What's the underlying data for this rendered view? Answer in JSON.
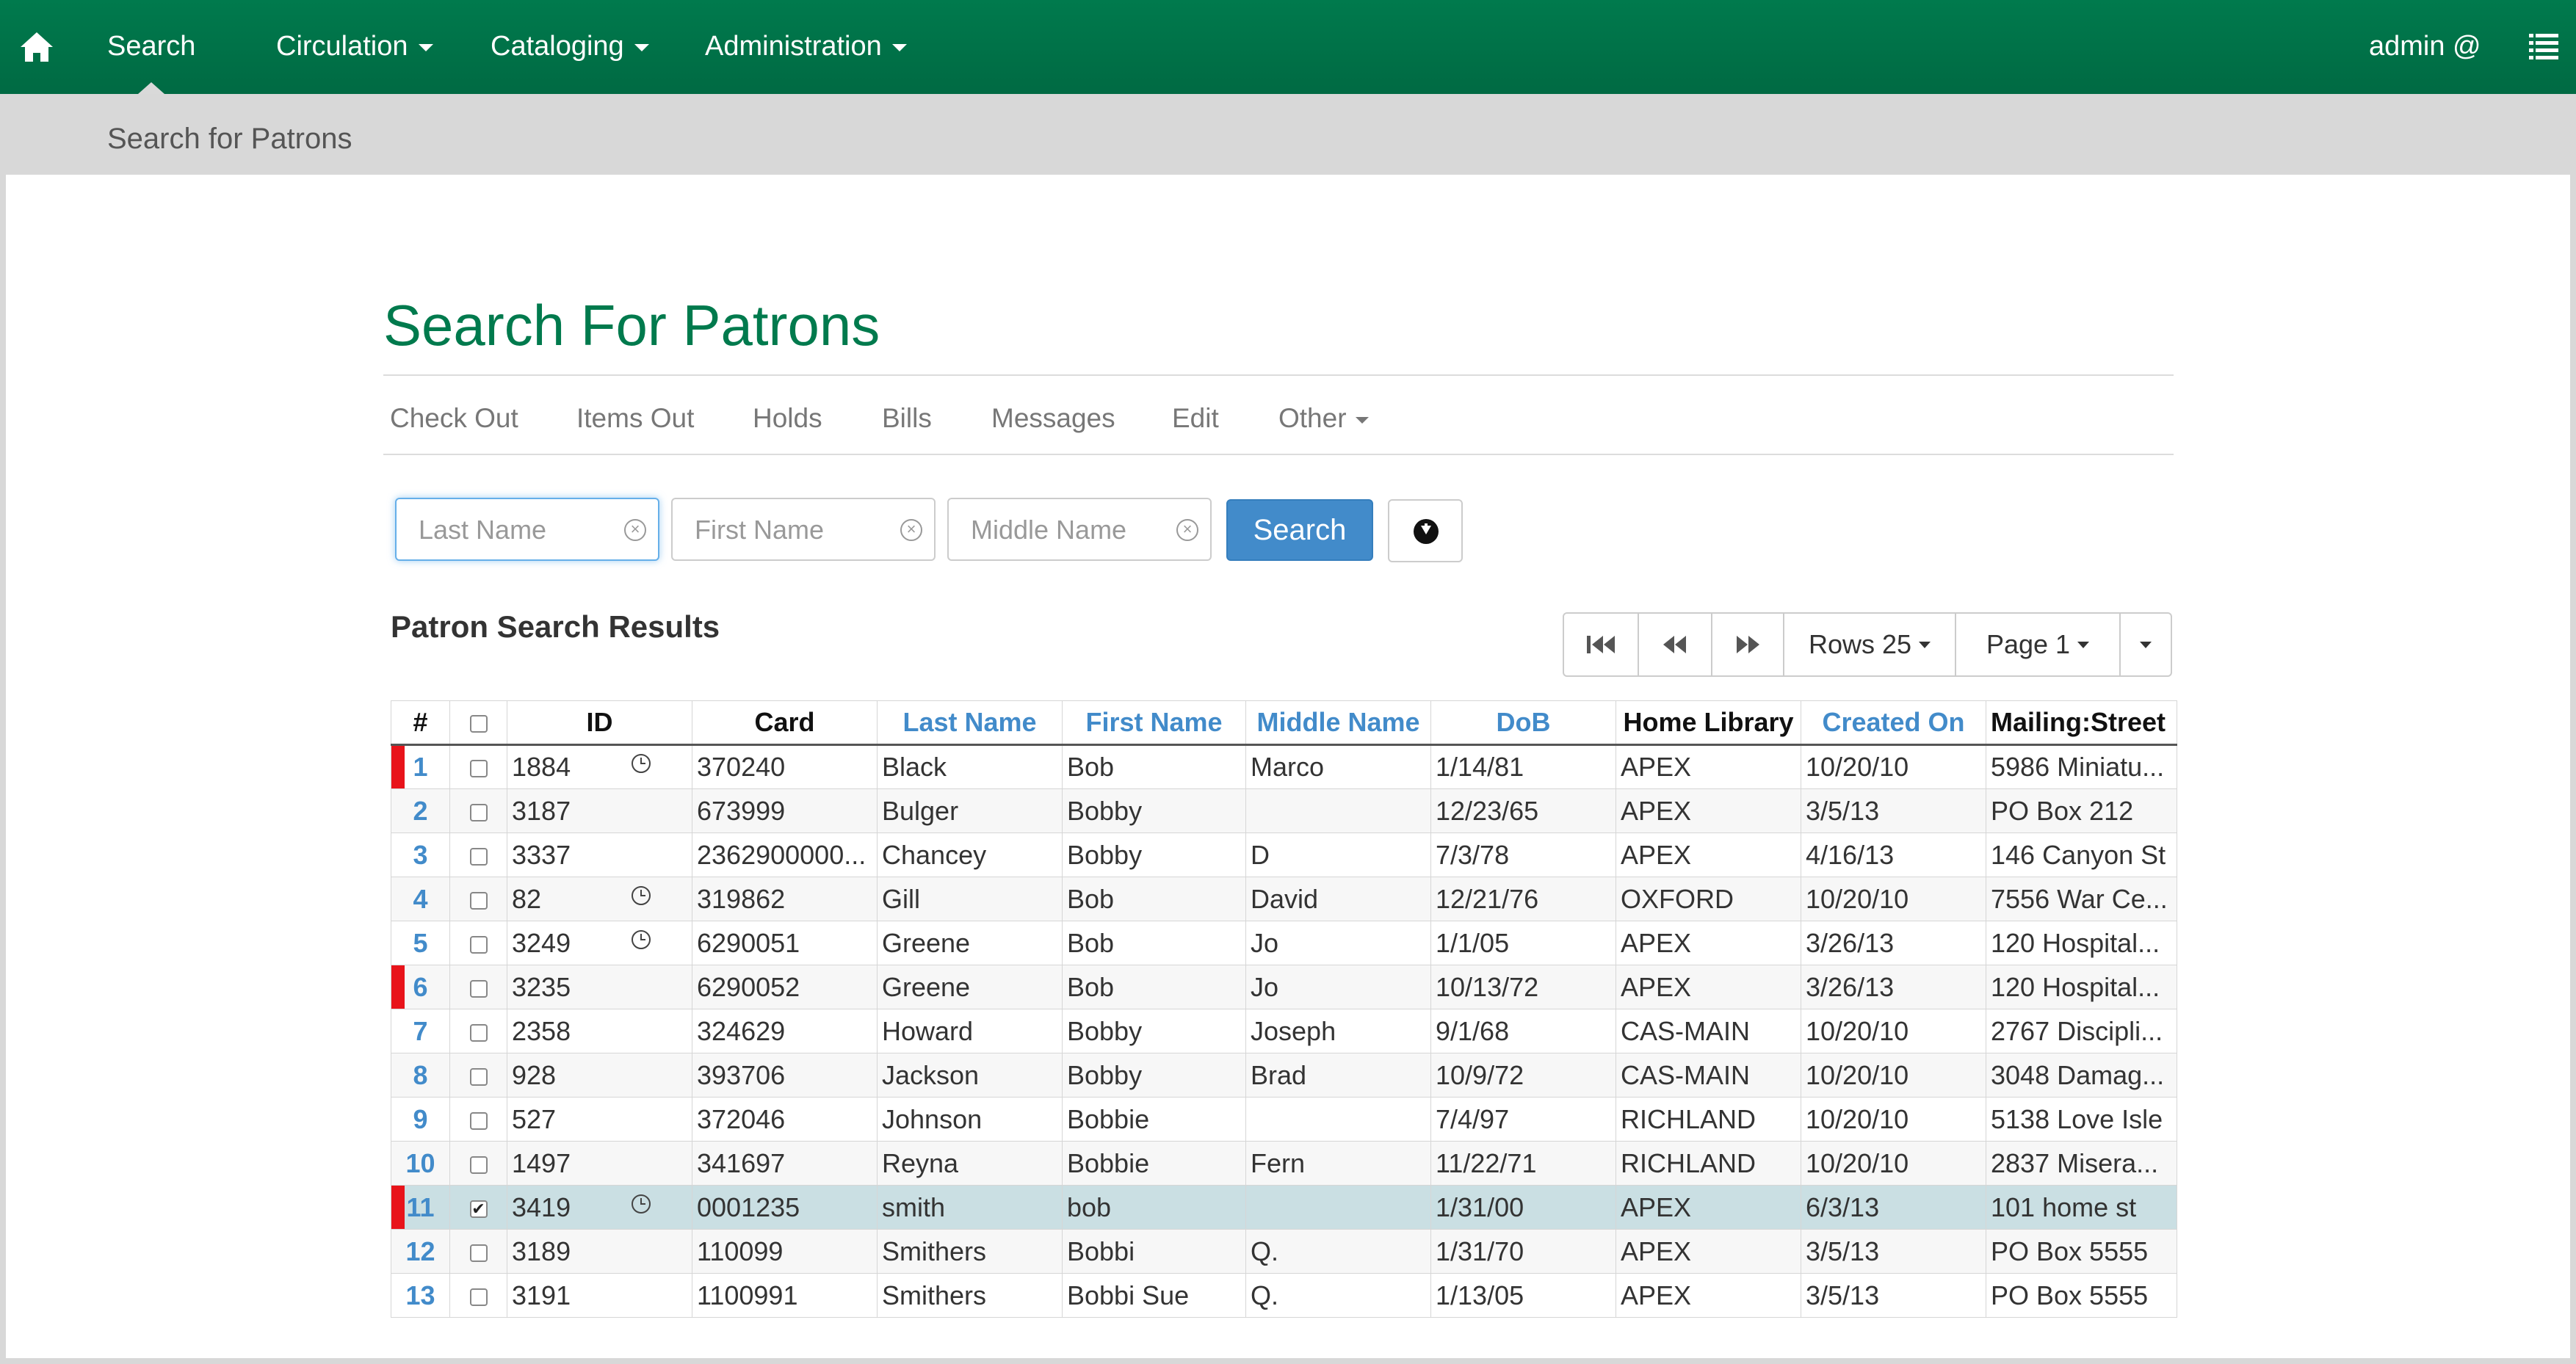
{
  "navbar": {
    "home_icon": "home-icon",
    "items": [
      {
        "label": "Search",
        "active": true
      },
      {
        "label": "Circulation",
        "dropdown": true
      },
      {
        "label": "Cataloging",
        "dropdown": true
      },
      {
        "label": "Administration",
        "dropdown": true
      }
    ],
    "user": "admin @",
    "menu_icon": "hamburger-menu-icon",
    "color": "#007a4d"
  },
  "subheader": {
    "title": "Search for Patrons"
  },
  "page": {
    "title": "Search For Patrons"
  },
  "actions": [
    "Check Out",
    "Items Out",
    "Holds",
    "Bills",
    "Messages",
    "Edit",
    "Other"
  ],
  "search": {
    "last_name_placeholder": "Last Name",
    "first_name_placeholder": "First Name",
    "middle_name_placeholder": "Middle Name",
    "search_label": "Search",
    "download_icon": "download-circle-icon"
  },
  "results": {
    "title": "Patron Search Results",
    "pager": {
      "rows_label": "Rows 25",
      "page_label": "Page 1"
    }
  },
  "table": {
    "columns": [
      "#",
      "",
      "ID",
      "Card",
      "Last Name",
      "First Name",
      "Middle Name",
      "DoB",
      "Home Library",
      "Created On",
      "Mailing:Street"
    ],
    "rows": [
      {
        "num": "1",
        "flag": true,
        "checked": false,
        "id": "1884",
        "clock": true,
        "card": "370240",
        "last": "Black",
        "first": "Bob",
        "middle": "Marco",
        "dob": "1/14/81",
        "lib": "APEX",
        "created": "10/20/10",
        "street": "5986 Miniatu..."
      },
      {
        "num": "2",
        "flag": false,
        "checked": false,
        "id": "3187",
        "clock": false,
        "card": "673999",
        "last": "Bulger",
        "first": "Bobby",
        "middle": "",
        "dob": "12/23/65",
        "lib": "APEX",
        "created": "3/5/13",
        "street": "PO Box 212"
      },
      {
        "num": "3",
        "flag": false,
        "checked": false,
        "id": "3337",
        "clock": false,
        "card": "2362900000...",
        "last": "Chancey",
        "first": "Bobby",
        "middle": "D",
        "dob": "7/3/78",
        "lib": "APEX",
        "created": "4/16/13",
        "street": "146 Canyon St"
      },
      {
        "num": "4",
        "flag": false,
        "checked": false,
        "id": "82",
        "clock": true,
        "card": "319862",
        "last": "Gill",
        "first": "Bob",
        "middle": "David",
        "dob": "12/21/76",
        "lib": "OXFORD",
        "created": "10/20/10",
        "street": "7556 War Ce..."
      },
      {
        "num": "5",
        "flag": false,
        "checked": false,
        "id": "3249",
        "clock": true,
        "card": "6290051",
        "last": "Greene",
        "first": "Bob",
        "middle": "Jo",
        "dob": "1/1/05",
        "lib": "APEX",
        "created": "3/26/13",
        "street": "120 Hospital..."
      },
      {
        "num": "6",
        "flag": true,
        "checked": false,
        "id": "3235",
        "clock": false,
        "card": "6290052",
        "last": "Greene",
        "first": "Bob",
        "middle": "Jo",
        "dob": "10/13/72",
        "lib": "APEX",
        "created": "3/26/13",
        "street": "120 Hospital..."
      },
      {
        "num": "7",
        "flag": false,
        "checked": false,
        "id": "2358",
        "clock": false,
        "card": "324629",
        "last": "Howard",
        "first": "Bobby",
        "middle": "Joseph",
        "dob": "9/1/68",
        "lib": "CAS-MAIN",
        "created": "10/20/10",
        "street": "2767 Discipli..."
      },
      {
        "num": "8",
        "flag": false,
        "checked": false,
        "id": "928",
        "clock": false,
        "card": "393706",
        "last": "Jackson",
        "first": "Bobby",
        "middle": "Brad",
        "dob": "10/9/72",
        "lib": "CAS-MAIN",
        "created": "10/20/10",
        "street": "3048 Damag..."
      },
      {
        "num": "9",
        "flag": false,
        "checked": false,
        "id": "527",
        "clock": false,
        "card": "372046",
        "last": "Johnson",
        "first": "Bobbie",
        "middle": "",
        "dob": "7/4/97",
        "lib": "RICHLAND",
        "created": "10/20/10",
        "street": "5138 Love Isle"
      },
      {
        "num": "10",
        "flag": false,
        "checked": false,
        "id": "1497",
        "clock": false,
        "card": "341697",
        "last": "Reyna",
        "first": "Bobbie",
        "middle": "Fern",
        "dob": "11/22/71",
        "lib": "RICHLAND",
        "created": "10/20/10",
        "street": "2837 Misera..."
      },
      {
        "num": "11",
        "flag": true,
        "checked": true,
        "selected": true,
        "id": "3419",
        "clock": true,
        "card": "0001235",
        "last": "smith",
        "first": "bob",
        "middle": "",
        "dob": "1/31/00",
        "lib": "APEX",
        "created": "6/3/13",
        "street": "101 home st"
      },
      {
        "num": "12",
        "flag": false,
        "checked": false,
        "id": "3189",
        "clock": false,
        "card": "110099",
        "last": "Smithers",
        "first": "Bobbi",
        "middle": "Q.",
        "dob": "1/31/70",
        "lib": "APEX",
        "created": "3/5/13",
        "street": "PO Box 5555"
      },
      {
        "num": "13",
        "flag": false,
        "checked": false,
        "id": "3191",
        "clock": false,
        "card": "1100991",
        "last": "Smithers",
        "first": "Bobbi Sue",
        "middle": "Q.",
        "dob": "1/13/05",
        "lib": "APEX",
        "created": "3/5/13",
        "street": "PO Box 5555"
      }
    ]
  }
}
